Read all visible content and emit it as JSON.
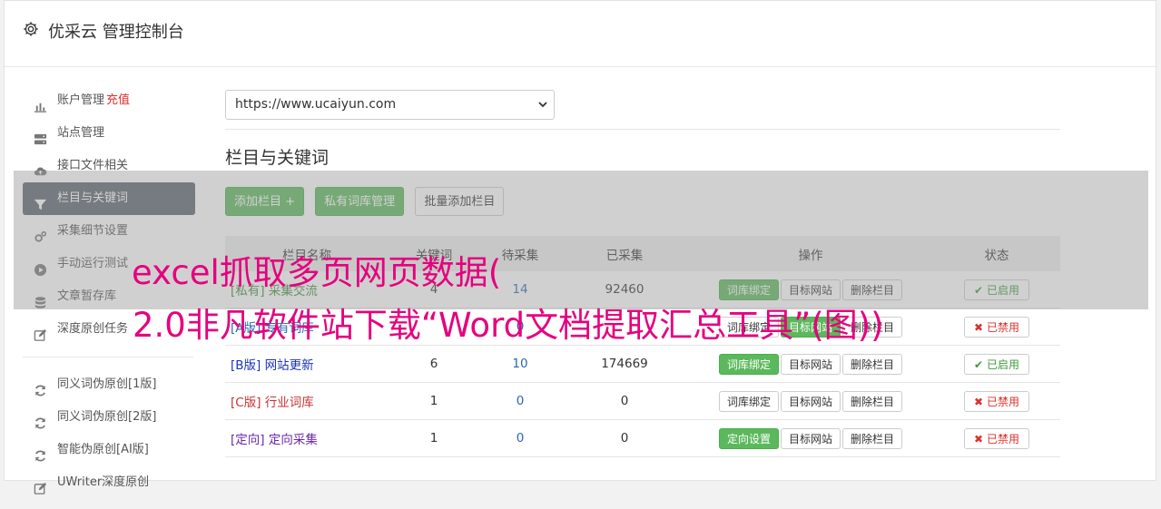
{
  "header": {
    "title": "优采云 管理控制台",
    "icon": "gear-icon"
  },
  "sidebar": {
    "items": [
      {
        "label": "账户管理",
        "extra": "充值",
        "icon": "bar-chart-icon"
      },
      {
        "label": "站点管理",
        "icon": "server-icon"
      },
      {
        "label": "接口文件相关",
        "icon": "cloud-upload-icon"
      },
      {
        "label": "栏目与关键词",
        "icon": "filter-icon",
        "active": true
      },
      {
        "label": "采集细节设置",
        "icon": "cogs-icon"
      },
      {
        "label": "手动运行测试",
        "icon": "play-icon"
      },
      {
        "label": "文章暂存库",
        "icon": "database-icon"
      },
      {
        "label": "深度原创任务",
        "icon": "edit-icon"
      }
    ],
    "items2": [
      {
        "label": "同义词伪原创[1版]",
        "icon": "refresh-icon"
      },
      {
        "label": "同义词伪原创[2版]",
        "icon": "refresh-icon"
      },
      {
        "label": "智能伪原创[AI版]",
        "icon": "refresh-icon"
      },
      {
        "label": "UWriter深度原创",
        "icon": "edit-icon"
      }
    ]
  },
  "site_select": {
    "value": "https://www.ucaiyun.com"
  },
  "section": {
    "title": "栏目与关键词"
  },
  "toolbar": {
    "add_column": "添加栏目 +",
    "private_lib": "私有词库管理",
    "batch_add": "批量添加栏目"
  },
  "table": {
    "headers": [
      "栏目名称",
      "关键词",
      "待采集",
      "已采集",
      "操作",
      "状态"
    ],
    "rows": [
      {
        "tag": "[私有]",
        "name": "采集交流",
        "kw": "4",
        "pending": "14",
        "collected": "92460",
        "op1": "词库绑定",
        "op1_primary": true,
        "op2": "目标网站",
        "op2_primary": false,
        "op3": "删除栏目",
        "status": "已启用",
        "enabled": true,
        "cls": "c-private"
      },
      {
        "tag": "[A版]",
        "name": "专有词库",
        "kw": "",
        "pending": "0",
        "collected": "",
        "op1": "词库绑定",
        "op1_primary": false,
        "op2": "目标网站",
        "op2_primary": true,
        "op3": "删除栏目",
        "status": "已禁用",
        "enabled": false,
        "cls": "c-a"
      },
      {
        "tag": "[B版]",
        "name": "网站更新",
        "kw": "6",
        "pending": "10",
        "collected": "174669",
        "op1": "词库绑定",
        "op1_primary": true,
        "op2": "目标网站",
        "op2_primary": false,
        "op3": "删除栏目",
        "status": "已启用",
        "enabled": true,
        "cls": "c-b"
      },
      {
        "tag": "[C版]",
        "name": "行业词库",
        "kw": "1",
        "pending": "0",
        "collected": "0",
        "op1": "词库绑定",
        "op1_primary": false,
        "op2": "目标网站",
        "op2_primary": false,
        "op3": "删除栏目",
        "status": "已禁用",
        "enabled": false,
        "cls": "c-c"
      },
      {
        "tag": "[定向]",
        "name": "定向采集",
        "kw": "1",
        "pending": "0",
        "collected": "0",
        "op1": "定向设置",
        "op1_primary": true,
        "op2": "目标网站",
        "op2_primary": false,
        "op3": "删除栏目",
        "status": "已禁用",
        "enabled": false,
        "cls": "c-d"
      }
    ]
  },
  "watermark": {
    "line1": "excel抓取多页网页数据(",
    "line2": "2.0非凡软件站下载“Word文档提取汇总工具”(图))"
  }
}
